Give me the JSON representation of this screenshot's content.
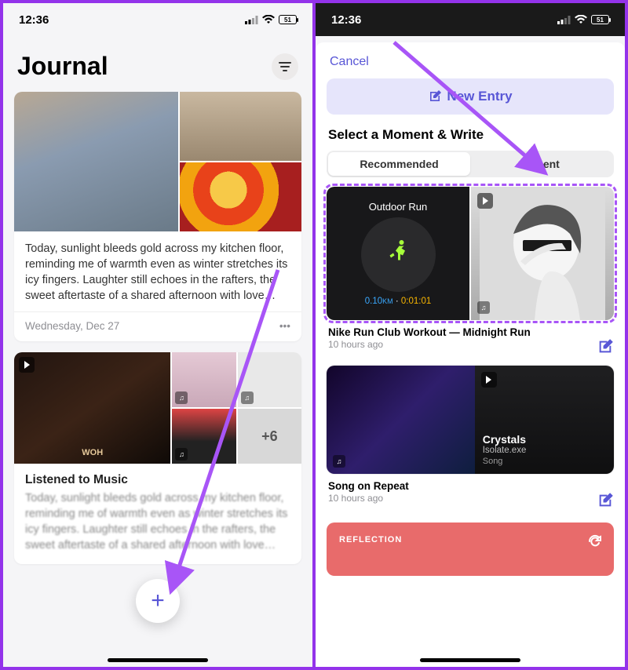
{
  "statusbar": {
    "time": "12:36",
    "battery": "51"
  },
  "phone1": {
    "title": "Journal",
    "entry1": {
      "text": "Today, sunlight bleeds gold across my kitchen floor, reminding me of warmth even as winter stretches its icy fingers. Laughter still echoes in the rafters, the sweet aftertaste of a shared afternoon with love…",
      "date": "Wednesday, Dec 27",
      "more": "•••"
    },
    "entry2": {
      "title": "Listened to Music",
      "album_label": "WOH",
      "overflow": "+6",
      "text": "Today, sunlight bleeds gold across my kitchen floor, reminding me of warmth even as winter stretches its icy fingers. Laughter still echoes in the rafters, the sweet aftertaste of a shared afternoon with love…"
    },
    "fab": "+"
  },
  "phone2": {
    "cancel": "Cancel",
    "new_entry": "New Entry",
    "section_title": "Select a Moment & Write",
    "segments": {
      "recommended": "Recommended",
      "recent": "Recent"
    },
    "moment1": {
      "tile_title": "Outdoor Run",
      "distance": "0.10",
      "distance_unit": "KM",
      "dot": " · ",
      "duration": "0:01:01",
      "title": "Nike Run Club Workout — Midnight Run",
      "time": "10 hours ago"
    },
    "moment2": {
      "song": "Crystals",
      "artist": "Isolate.exe",
      "type": "Song",
      "title": "Song on Repeat",
      "time": "10 hours ago"
    },
    "reflection": {
      "label": "REFLECTION"
    }
  }
}
